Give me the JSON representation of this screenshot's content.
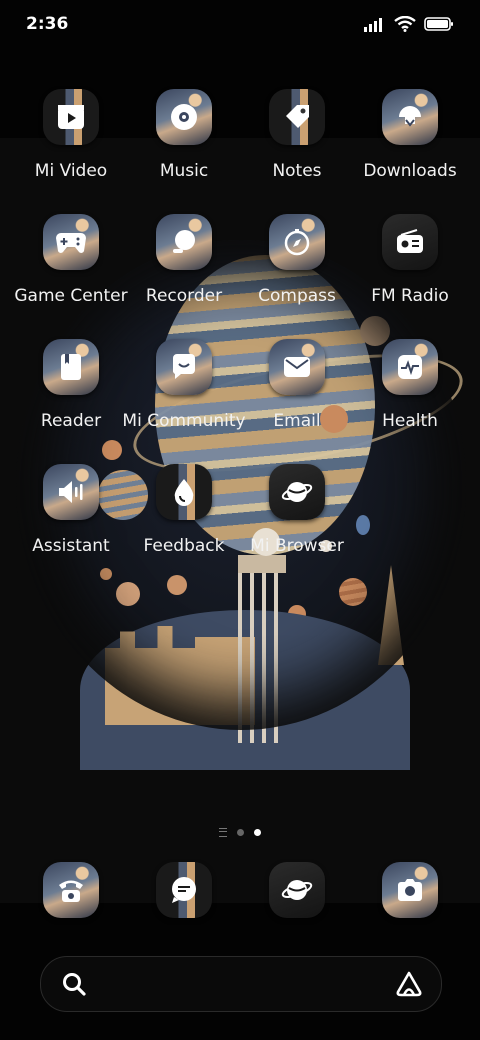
{
  "status_bar": {
    "time": "2:36",
    "icons": [
      "signal-icon",
      "wifi-icon",
      "battery-icon"
    ]
  },
  "apps": [
    {
      "label": "Mi Video",
      "icon": "play-icon"
    },
    {
      "label": "Music",
      "icon": "music-disc-icon"
    },
    {
      "label": "Notes",
      "icon": "tag-icon"
    },
    {
      "label": "Downloads",
      "icon": "download-icon"
    },
    {
      "label": "Game Center",
      "icon": "gamepad-icon"
    },
    {
      "label": "Recorder",
      "icon": "recorder-icon"
    },
    {
      "label": "Compass",
      "icon": "compass-icon"
    },
    {
      "label": "FM Radio",
      "icon": "radio-icon"
    },
    {
      "label": "Reader",
      "icon": "book-icon"
    },
    {
      "label": "Mi Community",
      "icon": "chat-bubble-icon"
    },
    {
      "label": "Email",
      "icon": "mail-icon"
    },
    {
      "label": "Health",
      "icon": "heartbeat-icon"
    },
    {
      "label": "Assistant",
      "icon": "speaker-icon"
    },
    {
      "label": "Feedback",
      "icon": "drop-icon"
    },
    {
      "label": "Mi Browser",
      "icon": "planet-icon"
    }
  ],
  "page_indicator": {
    "pages": 2,
    "active": 2,
    "has_feed_page": true
  },
  "dock": [
    {
      "icon": "phone-icon"
    },
    {
      "icon": "messages-icon"
    },
    {
      "icon": "browser-icon"
    },
    {
      "icon": "camera-icon"
    }
  ],
  "search_bar": {
    "left_icon": "search-icon",
    "right_icon": "assistant-icon"
  }
}
